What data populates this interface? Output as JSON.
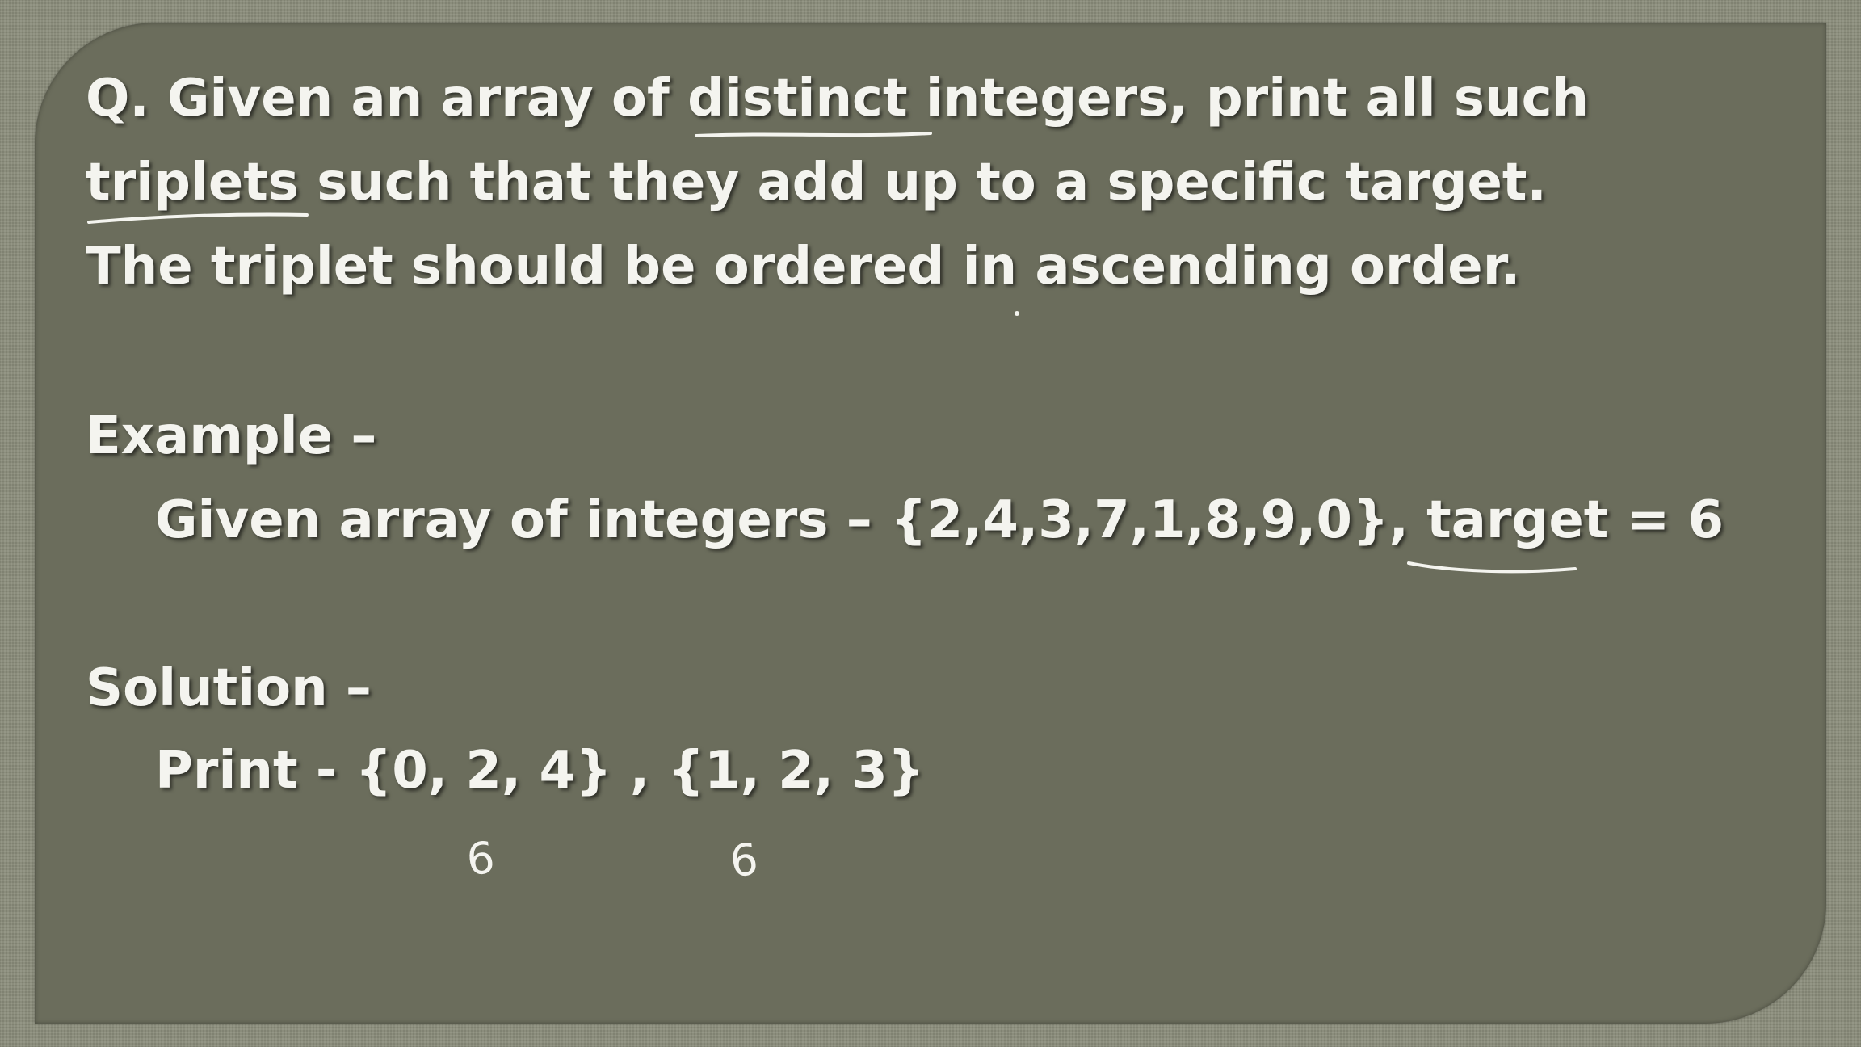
{
  "slide": {
    "question": {
      "line1_part1": "Q. Given an array of ",
      "line1_em": "distinct",
      "line1_part2": " integers, print all such",
      "line2_em": "triplets",
      "line2_rest": " such that they add up to a specific target.",
      "line3": "The triplet should be ordered in ascending order."
    },
    "example": {
      "heading": "Example –",
      "given_prefix": "Given array of integers – {2,4,3,7,1,8,9,0}, ",
      "target_word": "target",
      "target_rest": " = 6"
    },
    "solution": {
      "heading": "Solution –",
      "print_line": "Print - {0, 2, 4} , {1, 2, 3}"
    },
    "annotations": {
      "sum_first": "6",
      "sum_second": "6"
    }
  },
  "colors": {
    "slide_bg": "#6b6d5c",
    "outer_bg": "#8b8d7c",
    "text": "#f4f4ef"
  }
}
